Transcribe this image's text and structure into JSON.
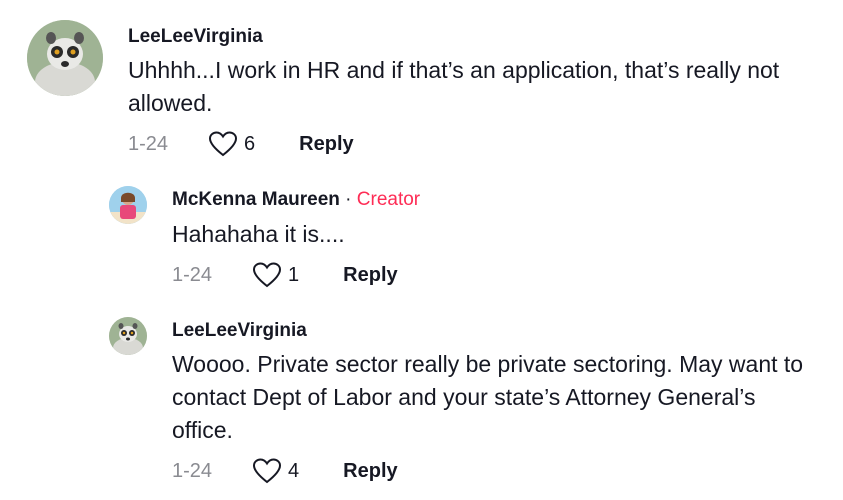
{
  "comments": [
    {
      "username": "LeeLeeVirginia",
      "text": "Uhhhh...I work in HR and if that’s an application, that’s really not allowed.",
      "date": "1-24",
      "likes": "6",
      "reply_label": "Reply"
    },
    {
      "username": "McKenna Maureen",
      "separator": "·",
      "badge": "Creator",
      "text": "Hahahaha it is....",
      "date": "1-24",
      "likes": "1",
      "reply_label": "Reply"
    },
    {
      "username": "LeeLeeVirginia",
      "text": "Woooo. Private sector really be private sectoring. May want to contact Dept of Labor and your state’s Attorney General’s office.",
      "date": "1-24",
      "likes": "4",
      "reply_label": "Reply"
    }
  ],
  "colors": {
    "creator_badge": "#fe2c55",
    "meta_gray": "#8a8b91",
    "text": "#161823"
  },
  "icons": {
    "like": "heart-outline-icon"
  }
}
